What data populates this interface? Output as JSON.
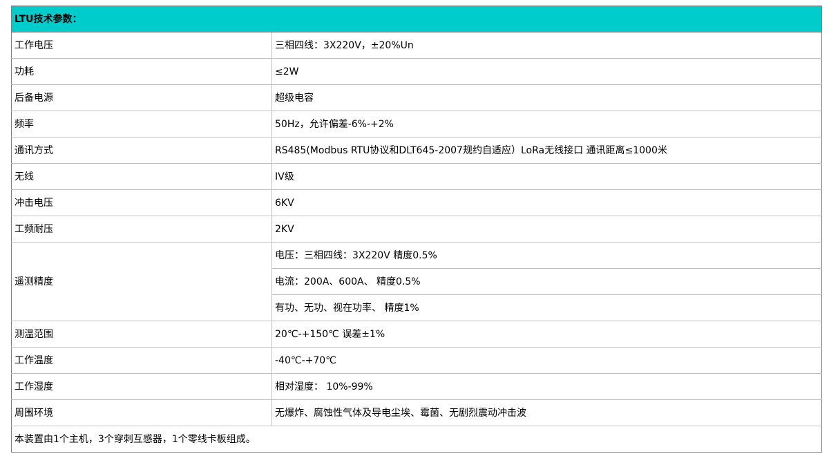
{
  "table": {
    "title": "LTU技术参数：",
    "rows": [
      {
        "label": "工作电压",
        "value": "三相四线：3X220V，±20%Un"
      },
      {
        "label": "功耗",
        "value": "≤2W"
      },
      {
        "label": "后备电源",
        "value": "超级电容"
      },
      {
        "label": "频率",
        "value": "50Hz，允许偏差-6%-+2%"
      },
      {
        "label": "通讯方式",
        "value": "RS485(Modbus RTU协议和DLT645-2007规约自适应）LoRa无线接口 通讯距离≤1000米"
      },
      {
        "label": "无线",
        "value": "IV级"
      },
      {
        "label": "冲击电压",
        "value": "6KV"
      },
      {
        "label": "工频耐压",
        "value": "2KV"
      }
    ],
    "accuracy": {
      "label": "遥测精度",
      "values": [
        "电压：三相四线：3X220V 精度0.5%",
        "电流：200A、600A、  精度0.5%",
        "有功、无功、视在功率、  精度1%"
      ]
    },
    "rows2": [
      {
        "label": "测温范围",
        "value": "20℃-+150℃  误差±1%"
      },
      {
        "label": "工作温度",
        "value": "-40℃-+70℃"
      },
      {
        "label": "工作湿度",
        "value": "相对湿度：  10%-99%"
      },
      {
        "label": "周围环境",
        "value": "无爆炸、腐蚀性气体及导电尘埃、霉菌、无剧烈震动冲击波"
      }
    ],
    "footer": "本装置由1个主机，3个穿刺互感器，1个零线卡板组成。"
  },
  "colors": {
    "header_bg": "#00cccc",
    "grid": "#bfbfbf",
    "outer_border": "#7f7f7f"
  }
}
